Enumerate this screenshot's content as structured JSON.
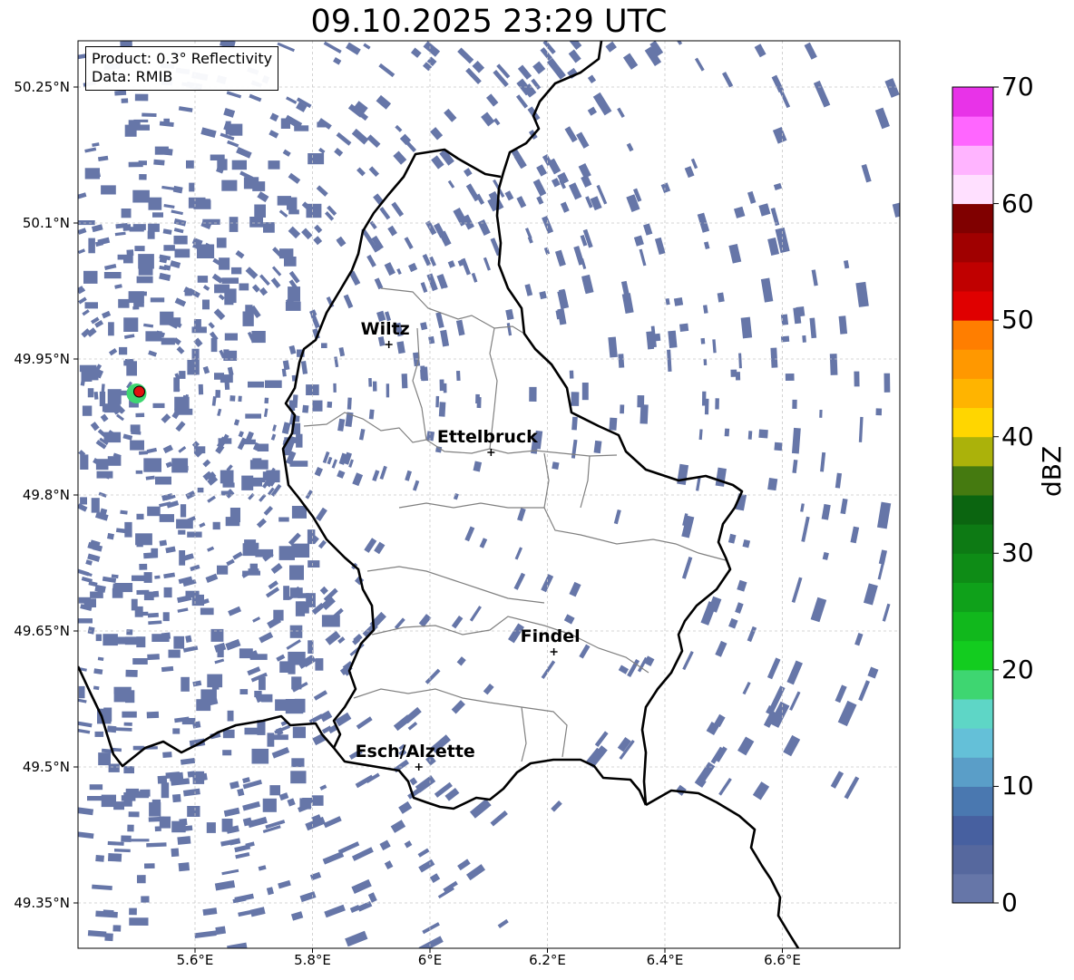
{
  "title": "09.10.2025 23:29 UTC",
  "info": {
    "product": "Product: 0.3° Reflectivity",
    "data": "Data: RMIB"
  },
  "lat_ticks": [
    "50.25°N",
    "50.1°N",
    "49.95°N",
    "49.8°N",
    "49.65°N",
    "49.5°N",
    "49.35°N"
  ],
  "lon_ticks": [
    "5.6°E",
    "5.8°E",
    "6°E",
    "6.2°E",
    "6.4°E",
    "6.6°E"
  ],
  "cities": [
    {
      "name": "Wiltz",
      "lon": 5.93,
      "lat": 49.966
    },
    {
      "name": "Ettelbruck",
      "lon": 6.104,
      "lat": 49.847
    },
    {
      "name": "Findel",
      "lon": 6.211,
      "lat": 49.627
    },
    {
      "name": "Esch/Alzette",
      "lon": 5.981,
      "lat": 49.5
    }
  ],
  "radar_site": {
    "lon": 5.505,
    "lat": 49.914
  },
  "colorbar": {
    "label": "dBZ",
    "ticks": [
      "0",
      "10",
      "20",
      "30",
      "40",
      "50",
      "60",
      "70"
    ],
    "min": 0,
    "max": 70,
    "step": 2.5,
    "colors": [
      "#6676a8",
      "#56689e",
      "#4760a0",
      "#4a78b0",
      "#5a9ec8",
      "#64c0d8",
      "#5ed6c6",
      "#3ed671",
      "#13cc1f",
      "#11b81c",
      "#0fa11a",
      "#0e8c16",
      "#0d7a14",
      "#0b6510",
      "#457a10",
      "#abb20a",
      "#ffd600",
      "#ffb400",
      "#ff9800",
      "#ff7e00",
      "#e00000",
      "#c00000",
      "#a00000",
      "#800000",
      "#ffe0ff",
      "#ffb4ff",
      "#ff66ff",
      "#e833e8"
    ]
  },
  "colors": {
    "echo": "#6676a8",
    "border": "#000000",
    "canton_lines": "#808080",
    "grid": "#c8c8c8",
    "radar_marker": "#e01010"
  }
}
